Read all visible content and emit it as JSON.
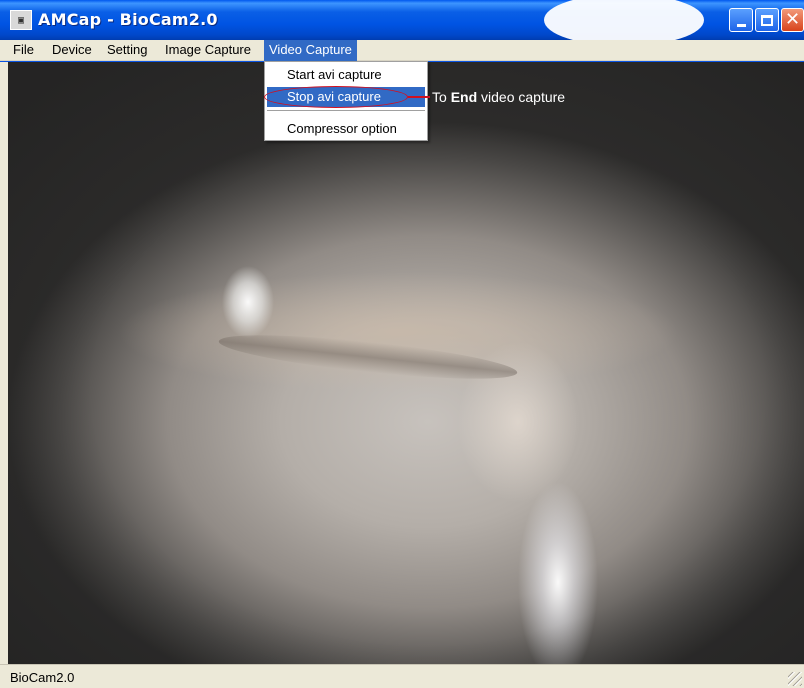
{
  "window": {
    "title": "AMCap - BioCam2.0",
    "app_icon": "camera-app-icon",
    "controls": [
      "minimize",
      "maximize",
      "close"
    ]
  },
  "menubar": {
    "items": [
      {
        "label": "File"
      },
      {
        "label": "Device"
      },
      {
        "label": "Setting"
      },
      {
        "label": "Image Capture"
      },
      {
        "label": "Video Capture",
        "active": true
      }
    ]
  },
  "dropdown": {
    "items": [
      {
        "label": "Start avi capture"
      },
      {
        "label": "Stop avi capture",
        "highlighted": true
      },
      {
        "label": "Compressor option"
      }
    ]
  },
  "annotation": {
    "prefix": "To ",
    "bold": "End",
    "suffix": " video capture",
    "color": "#d01020"
  },
  "statusbar": {
    "text": "BioCam2.0"
  },
  "colors": {
    "titlebar": "#0054e3",
    "menu_highlight": "#316ac5",
    "chrome": "#ece9d8"
  }
}
